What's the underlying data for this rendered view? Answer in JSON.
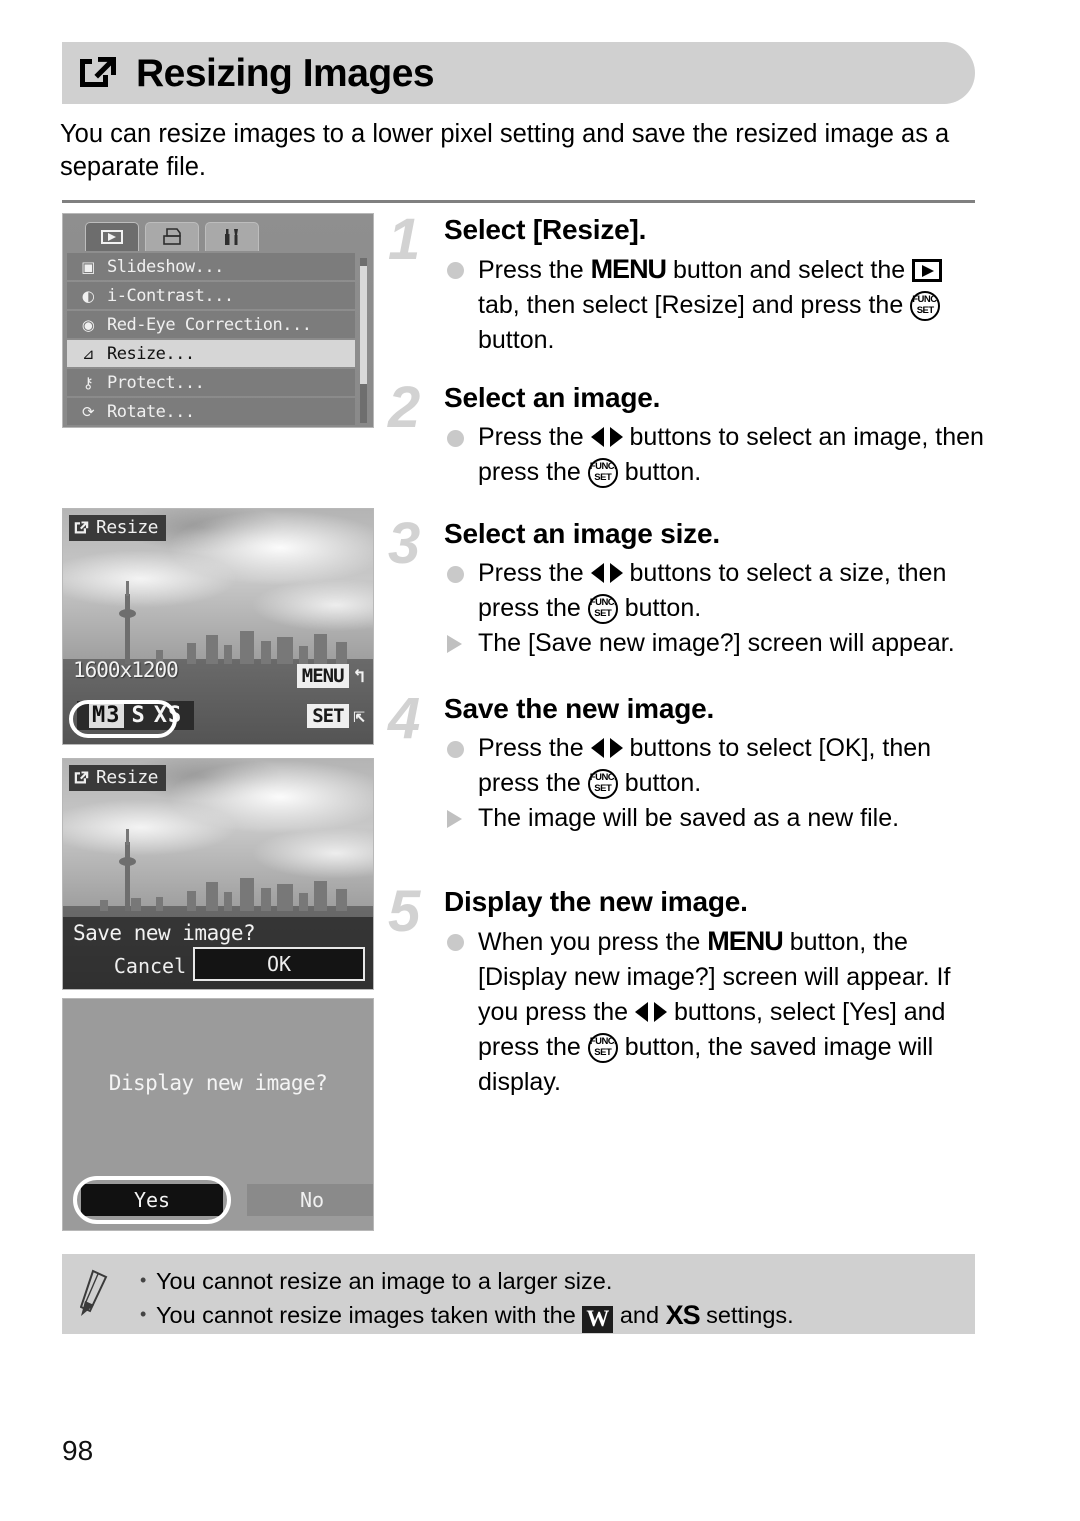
{
  "page": {
    "number": "98",
    "title": "Resizing Images",
    "title_icon": "resize-icon",
    "intro": "You can resize images to a lower pixel setting and save the resized image as a separate file."
  },
  "steps": [
    {
      "number": "1",
      "title": "Select [Resize].",
      "lines": [
        {
          "marker": "dot",
          "parts": [
            {
              "t": "text",
              "v": "Press the "
            },
            {
              "t": "icon",
              "v": "MENU",
              "name": "menu-button-icon"
            },
            {
              "t": "text",
              "v": " button and select the "
            },
            {
              "t": "icon",
              "v": "playback",
              "name": "playback-tab-icon"
            },
            {
              "t": "text",
              "v": " tab, then select [Resize] and press the "
            },
            {
              "t": "icon",
              "v": "FUNCSET",
              "name": "func-set-button-icon"
            },
            {
              "t": "text",
              "v": " button."
            }
          ]
        }
      ]
    },
    {
      "number": "2",
      "title": "Select an image.",
      "lines": [
        {
          "marker": "dot",
          "parts": [
            {
              "t": "text",
              "v": "Press the "
            },
            {
              "t": "icon",
              "v": "LEFTRIGHT",
              "name": "left-right-buttons-icon"
            },
            {
              "t": "text",
              "v": " buttons to select an image, then press the "
            },
            {
              "t": "icon",
              "v": "FUNCSET",
              "name": "func-set-button-icon"
            },
            {
              "t": "text",
              "v": " button."
            }
          ]
        }
      ]
    },
    {
      "number": "3",
      "title": "Select an image size.",
      "lines": [
        {
          "marker": "dot",
          "parts": [
            {
              "t": "text",
              "v": "Press the "
            },
            {
              "t": "icon",
              "v": "LEFTRIGHT",
              "name": "left-right-buttons-icon"
            },
            {
              "t": "text",
              "v": " buttons to select a size, then press the "
            },
            {
              "t": "icon",
              "v": "FUNCSET",
              "name": "func-set-button-icon"
            },
            {
              "t": "text",
              "v": " button."
            }
          ]
        },
        {
          "marker": "triangle",
          "parts": [
            {
              "t": "text",
              "v": "The [Save new image?] screen will appear."
            }
          ]
        }
      ]
    },
    {
      "number": "4",
      "title": "Save the new image.",
      "lines": [
        {
          "marker": "dot",
          "parts": [
            {
              "t": "text",
              "v": "Press the "
            },
            {
              "t": "icon",
              "v": "LEFTRIGHT",
              "name": "left-right-buttons-icon"
            },
            {
              "t": "text",
              "v": " buttons to select [OK], then press the "
            },
            {
              "t": "icon",
              "v": "FUNCSET",
              "name": "func-set-button-icon"
            },
            {
              "t": "text",
              "v": " button."
            }
          ]
        },
        {
          "marker": "triangle",
          "parts": [
            {
              "t": "text",
              "v": "The image will be saved as a new file."
            }
          ]
        }
      ]
    },
    {
      "number": "5",
      "title": "Display the new image.",
      "lines": [
        {
          "marker": "dot",
          "parts": [
            {
              "t": "text",
              "v": "When you press the "
            },
            {
              "t": "icon",
              "v": "MENU",
              "name": "menu-button-icon"
            },
            {
              "t": "text",
              "v": " button, the [Display new image?] screen will appear. If you press the "
            },
            {
              "t": "icon",
              "v": "LEFTRIGHT",
              "name": "left-right-buttons-icon"
            },
            {
              "t": "text",
              "v": " buttons, select [Yes] and press the "
            },
            {
              "t": "icon",
              "v": "FUNCSET",
              "name": "func-set-button-icon"
            },
            {
              "t": "text",
              "v": " button, the saved image will display."
            }
          ]
        }
      ]
    }
  ],
  "screens": {
    "menu_screen": {
      "tabs": [
        {
          "name": "playback-tab",
          "icon": "playback-icon",
          "active": true
        },
        {
          "name": "print-tab",
          "icon": "printer-icon",
          "active": false
        },
        {
          "name": "settings-tab",
          "icon": "wrench-hammer-icon",
          "active": false
        }
      ],
      "items": [
        {
          "label": "Slideshow...",
          "icon": "slideshow-icon",
          "selected": false
        },
        {
          "label": "i-Contrast...",
          "icon": "contrast-icon",
          "selected": false
        },
        {
          "label": "Red-Eye Correction...",
          "icon": "red-eye-icon",
          "selected": false
        },
        {
          "label": "Resize...",
          "icon": "resize-icon",
          "selected": true
        },
        {
          "label": "Protect...",
          "icon": "key-icon",
          "selected": false
        },
        {
          "label": "Rotate...",
          "icon": "rotate-icon",
          "selected": false
        }
      ]
    },
    "size_screen": {
      "badge": "Resize",
      "resolution": "1600x1200",
      "sizes": [
        "M3",
        "S",
        "XS"
      ],
      "selected_size": "M3",
      "menu_key": "MENU",
      "set_key": "SET"
    },
    "save_screen": {
      "badge": "Resize",
      "question": "Save new image?",
      "cancel_label": "Cancel",
      "ok_label": "OK",
      "selected_button": "OK"
    },
    "display_screen": {
      "question": "Display new image?",
      "yes_label": "Yes",
      "no_label": "No",
      "selected_button": "Yes"
    }
  },
  "note": {
    "lines": [
      [
        {
          "t": "text",
          "v": "You cannot resize an image to a larger size."
        }
      ],
      [
        {
          "t": "text",
          "v": "You cannot resize images taken with the "
        },
        {
          "t": "icon",
          "v": "WIDE",
          "name": "widescreen-setting-icon"
        },
        {
          "t": "text",
          "v": " and "
        },
        {
          "t": "icon",
          "v": "XSBOLD",
          "name": "xs-setting-icon"
        },
        {
          "t": "text",
          "v": " settings."
        }
      ]
    ]
  },
  "colors": {
    "header_bg": "#d0d0d0",
    "note_bg": "#d0d0d0",
    "step_number": "#d2d2d2",
    "rule": "#808080"
  }
}
